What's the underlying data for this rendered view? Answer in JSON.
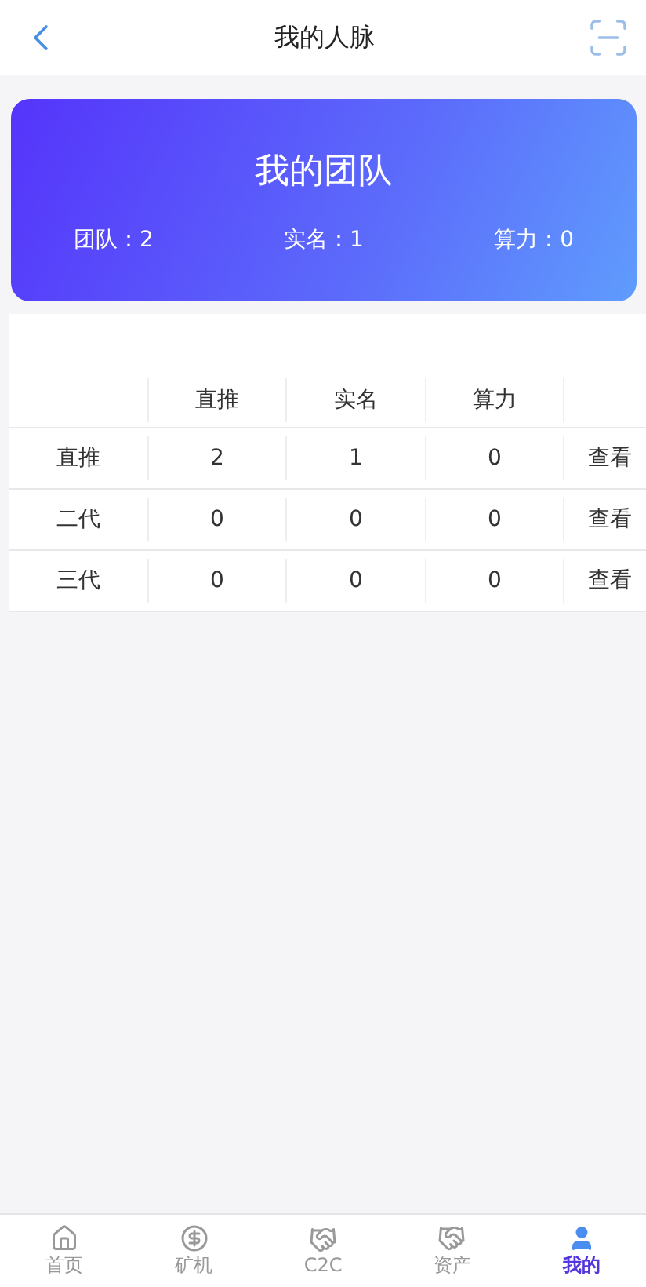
{
  "header": {
    "title": "我的人脉"
  },
  "team_card": {
    "title": "我的团队",
    "stats": [
      {
        "label": "团队：2"
      },
      {
        "label": "实名：1"
      },
      {
        "label": "算力：0"
      }
    ]
  },
  "table": {
    "columns": [
      "直推",
      "实名",
      "算力"
    ],
    "rows": [
      {
        "name": "直推",
        "values": [
          "2",
          "1",
          "0"
        ],
        "action": "查看"
      },
      {
        "name": "二代",
        "values": [
          "0",
          "0",
          "0"
        ],
        "action": "查看"
      },
      {
        "name": "三代",
        "values": [
          "0",
          "0",
          "0"
        ],
        "action": "查看"
      }
    ]
  },
  "tab_bar": [
    {
      "label": "首页",
      "selected": false
    },
    {
      "label": "矿机",
      "selected": false
    },
    {
      "label": "C2C",
      "selected": false
    },
    {
      "label": "资产",
      "selected": false
    },
    {
      "label": "我的",
      "selected": true
    }
  ]
}
